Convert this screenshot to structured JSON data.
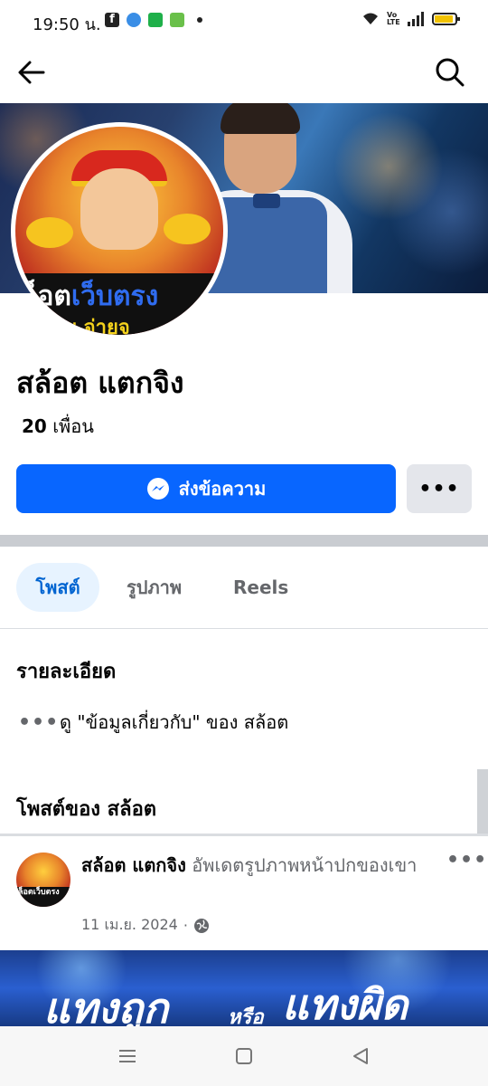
{
  "status_bar": {
    "time": "19:50 น.",
    "net_label": "Vo LTE",
    "icons": [
      "facebook-icon",
      "messenger-icon",
      "line-icon",
      "android-app-icon",
      "notification-dot",
      "wifi-icon",
      "volte-icon",
      "signal-icon",
      "battery-icon"
    ]
  },
  "header": {
    "back_icon": "back-arrow-icon",
    "search_icon": "search-icon"
  },
  "cover": {
    "accent": "#2f6cf0"
  },
  "avatar": {
    "line1_a": "ล็อต",
    "line1_b": "เว็บตรง",
    "line2": "จ่าย จ่ายจ"
  },
  "profile": {
    "name": "สล้อต แตกจิง",
    "friends_count": "20",
    "friends_label": "เพื่อน"
  },
  "actions": {
    "message_label": "ส่งข้อความ",
    "message_icon": "messenger-icon",
    "more_label": "•••"
  },
  "tabs": [
    {
      "label": "โพสต์",
      "active": true
    },
    {
      "label": "รูปภาพ",
      "active": false
    },
    {
      "label": "Reels",
      "active": false
    }
  ],
  "details": {
    "title": "รายละเอียด",
    "dots": "•••",
    "about_text": "ดู \"ข้อมูลเกี่ยวกับ\" ของ สล้อต"
  },
  "posts_section": {
    "title": "โพสต์ของ สล้อต"
  },
  "post": {
    "avatar_text": "ล็อตเว็บตรง",
    "author": "สล้อต แตกจิง",
    "action_text": " อัพเดตรูปภาพหน้าปกของเขา",
    "date": "11 เม.ย. 2024",
    "separator": "·",
    "privacy_icon": "globe-icon",
    "more_label": "•••",
    "image_text_1": "แทงถูก",
    "image_text_2": "หรือ",
    "image_text_3": "แทงผิด"
  },
  "colors": {
    "facebook_blue": "#0866ff",
    "tab_active_bg": "#e7f3ff",
    "tab_active_text": "#0064d1",
    "secondary_text": "#65676b",
    "divider": "#c9ccd1"
  },
  "android_nav": {
    "icons": [
      "menu-icon",
      "home-square-icon",
      "back-triangle-icon"
    ]
  }
}
